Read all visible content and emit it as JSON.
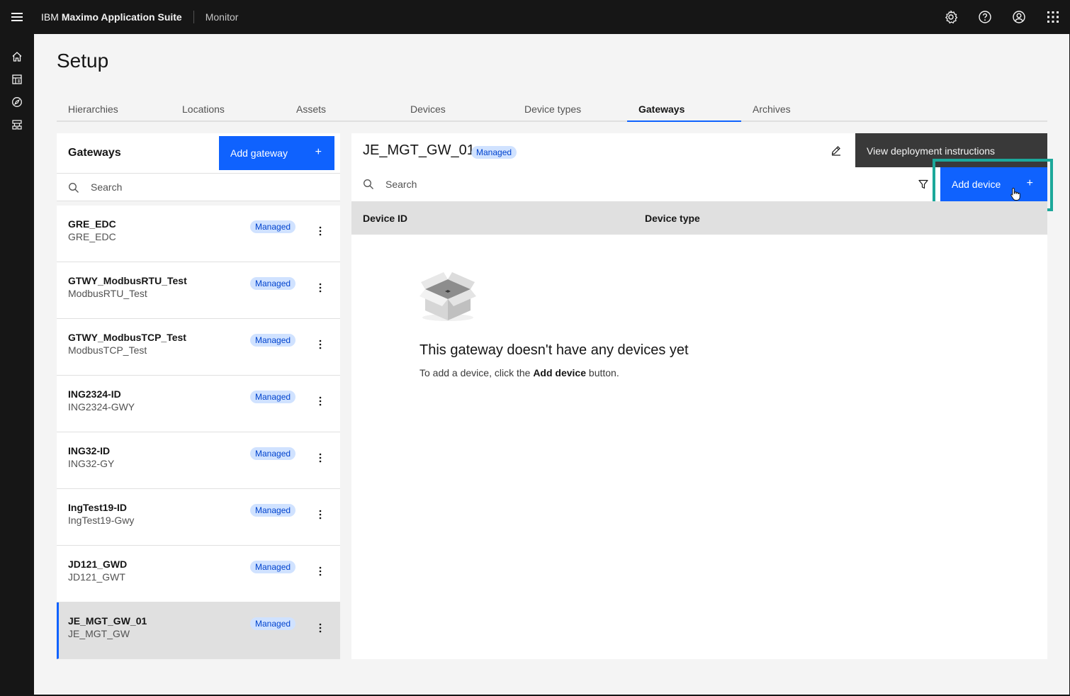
{
  "header": {
    "brand_ibm": "IBM",
    "brand_product": "Maximo Application Suite",
    "app_name": "Monitor",
    "icons": [
      "gear-icon",
      "help-icon",
      "user-avatar-icon",
      "app-switcher-icon"
    ]
  },
  "siderail": {
    "icons": [
      "home-icon",
      "dashboard-icon",
      "compass-icon",
      "hierarchy-icon"
    ]
  },
  "page": {
    "title": "Setup"
  },
  "tabs": [
    {
      "label": "Hierarchies",
      "active": false
    },
    {
      "label": "Locations",
      "active": false
    },
    {
      "label": "Assets",
      "active": false
    },
    {
      "label": "Devices",
      "active": false
    },
    {
      "label": "Device types",
      "active": false
    },
    {
      "label": "Gateways",
      "active": true
    },
    {
      "label": "Archives",
      "active": false
    }
  ],
  "gateways_panel": {
    "title": "Gateways",
    "add_button_label": "Add gateway",
    "search_placeholder": "Search",
    "items": [
      {
        "name": "GRE_EDC",
        "sub": "GRE_EDC",
        "badge": "Managed"
      },
      {
        "name": "GTWY_ModbusRTU_Test",
        "sub": "ModbusRTU_Test",
        "badge": "Managed"
      },
      {
        "name": "GTWY_ModbusTCP_Test",
        "sub": "ModbusTCP_Test",
        "badge": "Managed"
      },
      {
        "name": "ING2324-ID",
        "sub": "ING2324-GWY",
        "badge": "Managed"
      },
      {
        "name": "ING32-ID",
        "sub": "ING32-GY",
        "badge": "Managed"
      },
      {
        "name": "IngTest19-ID",
        "sub": "IngTest19-Gwy",
        "badge": "Managed"
      },
      {
        "name": "JD121_GWD",
        "sub": "JD121_GWT",
        "badge": "Managed"
      },
      {
        "name": "JE_MGT_GW_01",
        "sub": "JE_MGT_GW",
        "badge": "Managed",
        "selected": true
      }
    ]
  },
  "detail": {
    "title": "JE_MGT_GW_01",
    "badge": "Managed",
    "deploy_label": "View deployment instructions",
    "search_placeholder": "Search",
    "add_device_label": "Add device",
    "columns": [
      "Device ID",
      "Device type"
    ],
    "empty_title": "This gateway doesn't have any devices yet",
    "empty_text_pre": "To add a device, click the ",
    "empty_text_bold": "Add device",
    "empty_text_post": " button."
  },
  "colors": {
    "accent": "#0f62fe",
    "highlight": "#1ca89a",
    "badge_bg": "#d0e2ff",
    "badge_text": "#0043ce"
  }
}
